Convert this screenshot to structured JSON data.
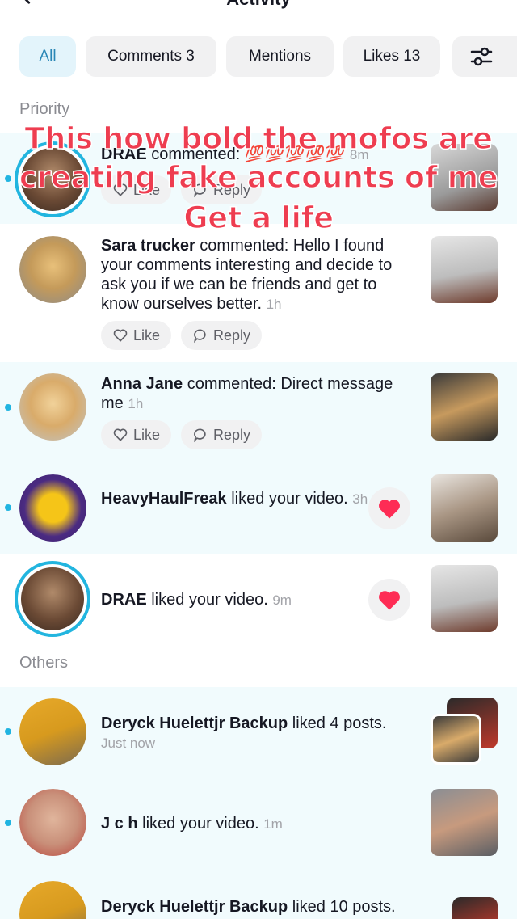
{
  "header": {
    "title": "Activity"
  },
  "filters": [
    {
      "label": "All",
      "active": true
    },
    {
      "label": "Comments 3"
    },
    {
      "label": "Mentions"
    },
    {
      "label": "Likes 13"
    }
  ],
  "sections": {
    "priority": "Priority",
    "others": "Others"
  },
  "overlay": {
    "line1": "This how bold the mofos are",
    "line2": "creating fake accounts of me",
    "line3": "Get a life"
  },
  "rows": [
    {
      "name": "DRAE",
      "text": " commented: 💯💯💯💯💯",
      "time": "8m",
      "like": "Like",
      "reply": "Reply"
    },
    {
      "name": "Sara trucker",
      "text": " commented: Hello I found your comments interesting and decide to ask you if we can be friends and get to know ourselves better.",
      "time": "1h",
      "like": "Like",
      "reply": "Reply"
    },
    {
      "name": "Anna Jane",
      "text": " commented: Direct message me",
      "time": "1h",
      "like": "Like",
      "reply": "Reply"
    },
    {
      "name": "HeavyHaulFreak",
      "text": " liked your video.",
      "time": "3h"
    },
    {
      "name": "DRAE",
      "text": " liked your video.",
      "time": "9m"
    },
    {
      "name": "Deryck Huelettjr Backup",
      "text": " liked 4 posts.",
      "time": "Just now"
    },
    {
      "name": "J c h",
      "text": " liked your video.",
      "time": "1m"
    },
    {
      "name": "Deryck Huelettjr Backup",
      "text": " liked 10 posts."
    }
  ],
  "colors": {
    "accent": "#20b4e1",
    "overlay": "#ee3d50",
    "heart": "#fe2c55"
  }
}
